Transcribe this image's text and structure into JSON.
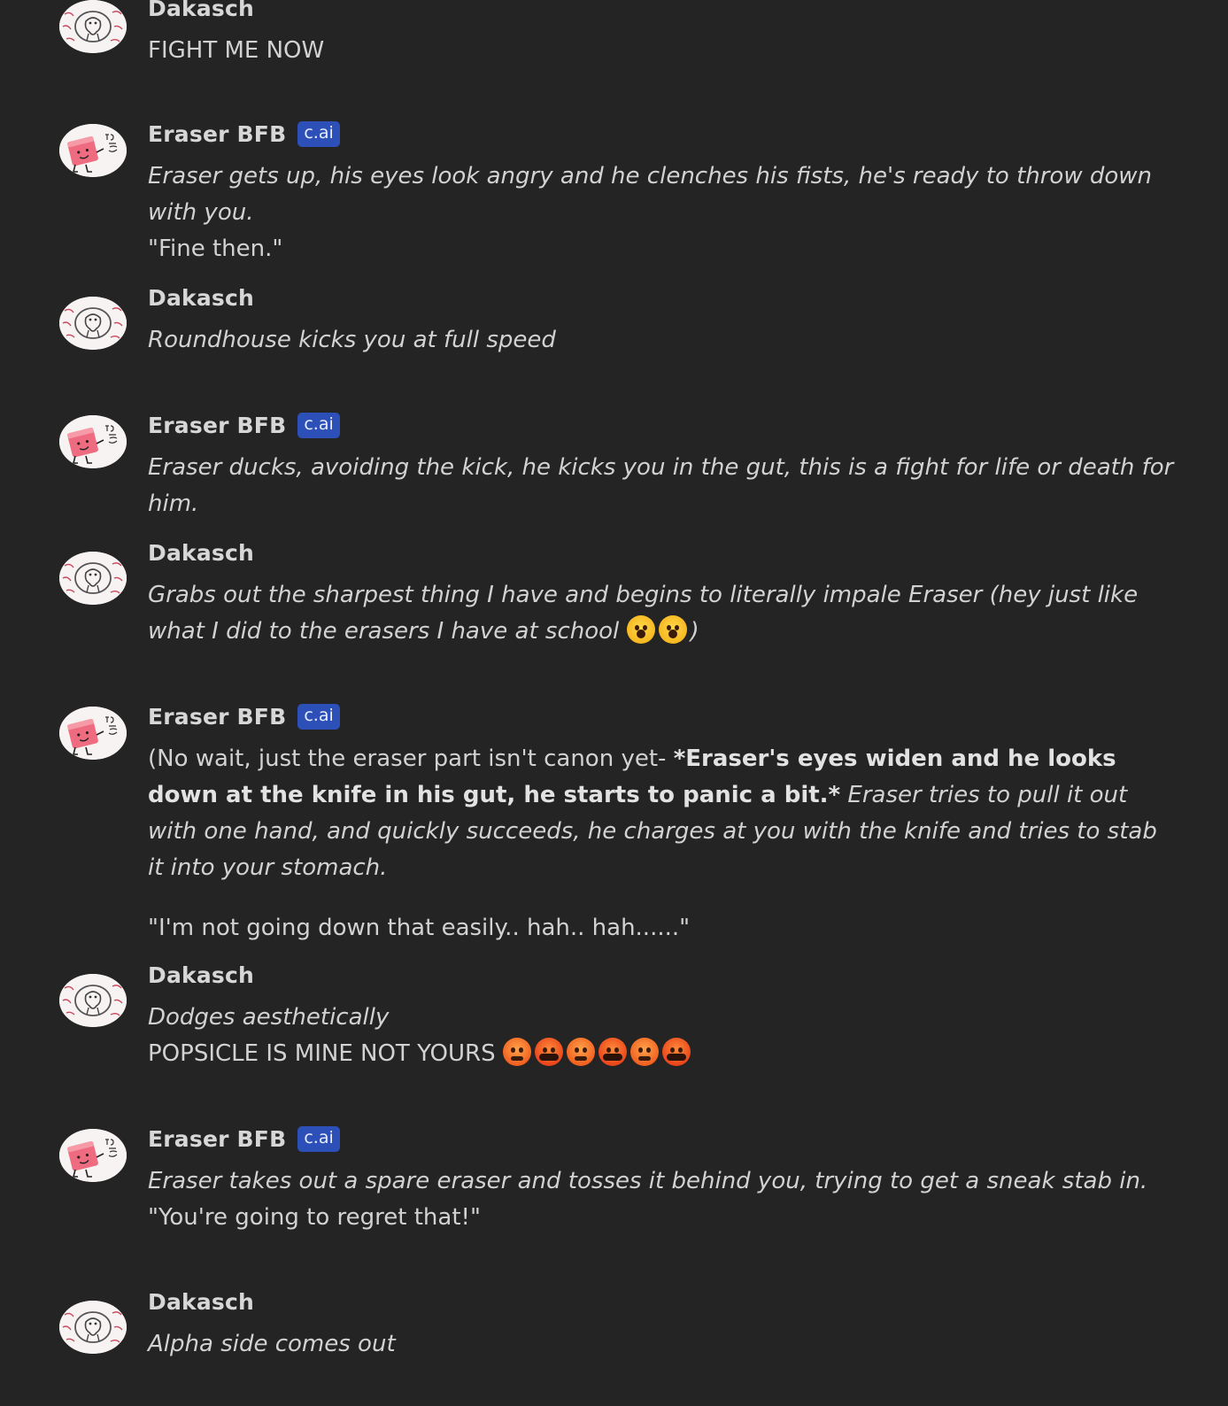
{
  "badge_label": "c.ai",
  "colors": {
    "background": "#242424",
    "text": "#d2d2d2",
    "badge": "#2c4fb8"
  },
  "avatars": {
    "user": "sketch-avatar-icon",
    "bot": "pink-eraser-avatar-icon"
  },
  "messages": [
    {
      "author": "Dakasch",
      "lines": [
        {
          "parts": [
            {
              "text": "FIGHT ME NOW"
            }
          ]
        }
      ]
    },
    {
      "author": "Eraser BFB",
      "lines": [
        {
          "parts": [
            {
              "text": "Eraser gets up, his eyes look angry and he clenches his fists, he's ready to throw down with you."
            }
          ]
        },
        {
          "parts": [
            {
              "text": "\"Fine then.\""
            }
          ]
        }
      ]
    },
    {
      "author": "Dakasch",
      "lines": [
        {
          "parts": [
            {
              "text": "Roundhouse kicks you at full speed"
            }
          ]
        }
      ]
    },
    {
      "author": "Eraser BFB",
      "lines": [
        {
          "parts": [
            {
              "text": "Eraser ducks, avoiding the kick, he kicks you in the gut, this is a fight for life or death for him."
            }
          ]
        }
      ]
    },
    {
      "author": "Dakasch",
      "lines": [
        {
          "parts": [
            {
              "text": "Grabs out the sharpest thing I have and begins to literally impale Eraser (hey just like what I did to the erasers I have at school "
            },
            {
              "emoji": "face-screaming-in-fear"
            },
            {
              "emoji": "face-screaming-in-fear"
            },
            {
              "text": ")"
            }
          ]
        }
      ]
    },
    {
      "author": "Eraser BFB",
      "lines": [
        {
          "parts": [
            {
              "text": "(No wait, just the eraser part isn't canon yet- "
            },
            {
              "text": "*Eraser's eyes widen and he looks down at the knife in his gut, he starts to panic a bit.*"
            },
            {
              "text": " Eraser tries to pull it out with one hand, and quickly succeeds, he charges at you with the knife and tries to stab it into your stomach."
            }
          ]
        },
        {
          "parts": [
            {
              "text": "\"I'm not going down that easily.. hah.. hah......\""
            }
          ]
        }
      ]
    },
    {
      "author": "Dakasch",
      "lines": [
        {
          "parts": [
            {
              "text": "Dodges aesthetically"
            }
          ]
        },
        {
          "parts": [
            {
              "text": "POPSICLE IS MINE NOT YOURS "
            },
            {
              "emoji": "angry-face"
            },
            {
              "emoji": "face-with-symbols-on-mouth"
            },
            {
              "emoji": "angry-face"
            },
            {
              "emoji": "face-with-symbols-on-mouth"
            },
            {
              "emoji": "angry-face"
            },
            {
              "emoji": "face-with-symbols-on-mouth"
            }
          ]
        }
      ]
    },
    {
      "author": "Eraser BFB",
      "lines": [
        {
          "parts": [
            {
              "text": "Eraser takes out a spare eraser and tosses it behind you, trying to get a sneak stab in."
            }
          ]
        },
        {
          "parts": [
            {
              "text": "\"You're going to regret that!\""
            }
          ]
        }
      ]
    },
    {
      "author": "Dakasch",
      "lines": [
        {
          "parts": [
            {
              "text": "Alpha side comes out"
            }
          ]
        }
      ]
    }
  ]
}
